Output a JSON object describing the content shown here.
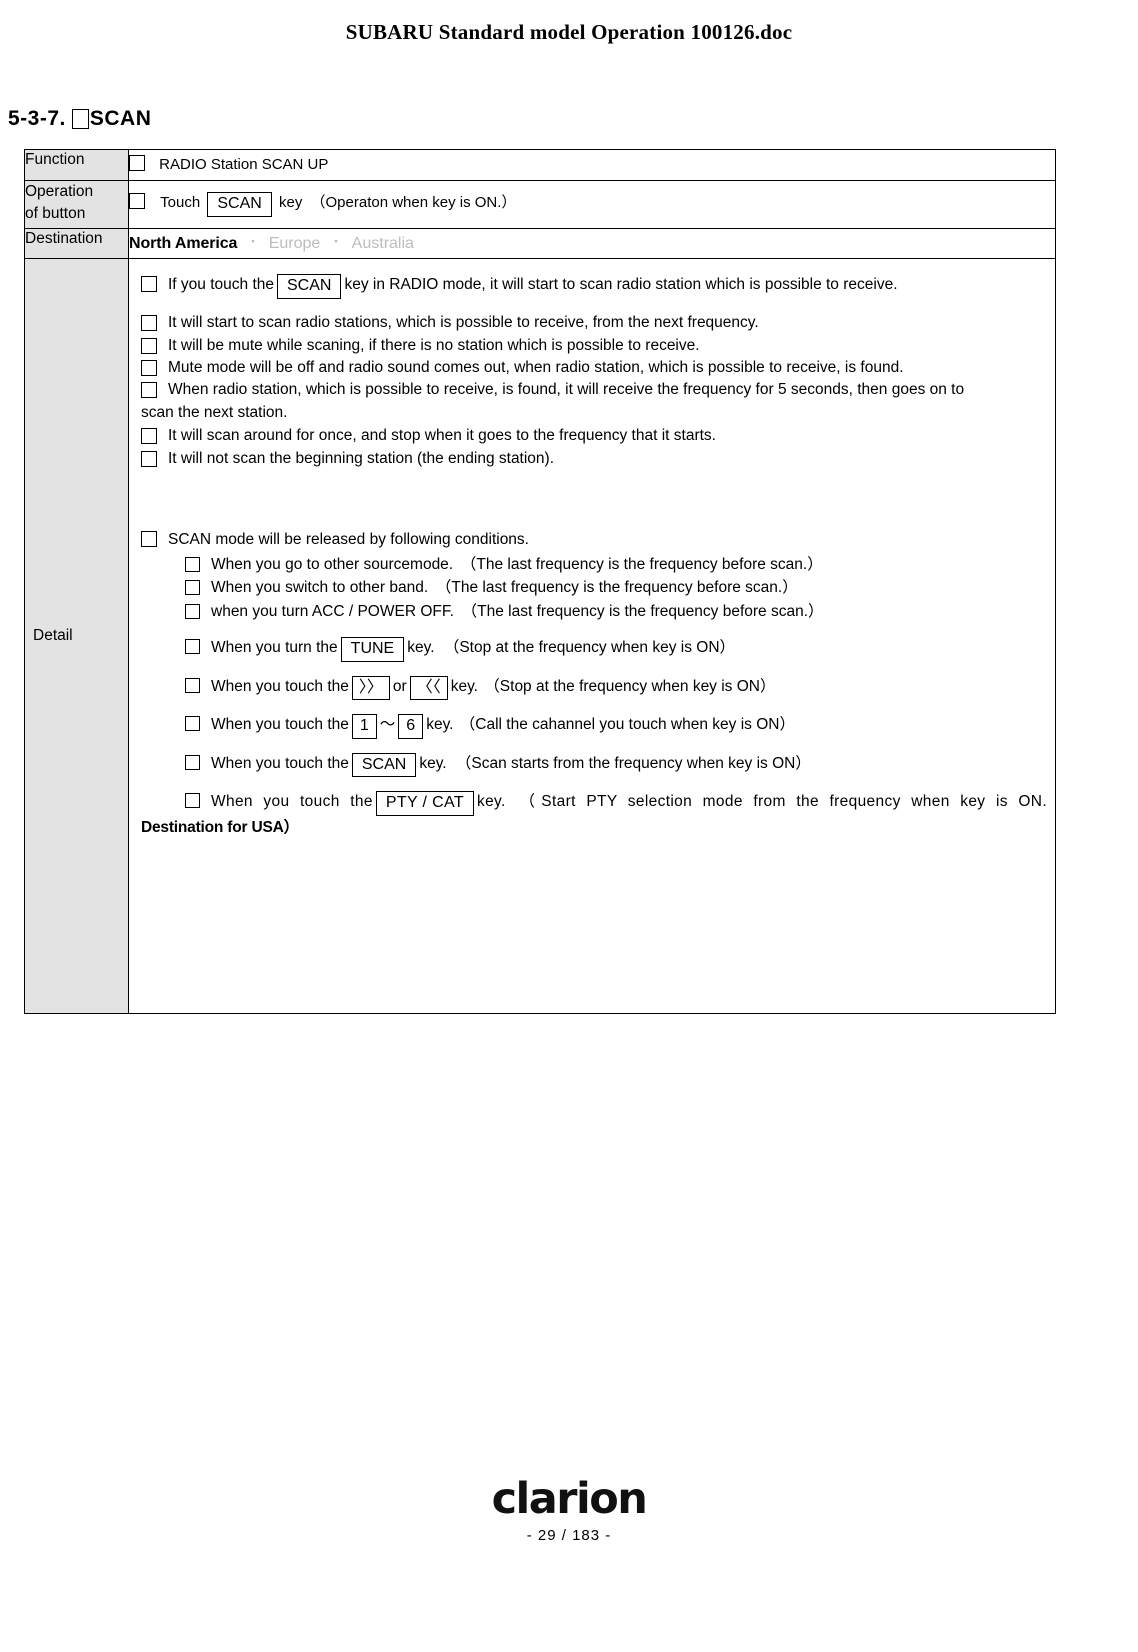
{
  "document": {
    "header_title": "SUBARU Standard model Operation 100126.doc",
    "section_number": "5-3-7.",
    "section_title": "SCAN"
  },
  "table": {
    "labels": {
      "function": "Function",
      "operation_line1": "Operation",
      "operation_line2": "of button",
      "destination": "Destination",
      "detail": "Detail"
    },
    "function": {
      "text": "RADIO Station SCAN  UP"
    },
    "operation": {
      "prefix": "Touch",
      "key": "SCAN",
      "suffix": "key",
      "note": "（Operaton when key is ON.）"
    },
    "destination": {
      "active": "North America",
      "separator": "・",
      "option2": "Europe",
      "option3": "Australia"
    },
    "detail": {
      "intro": {
        "prefix": "If you touch the",
        "key": "SCAN",
        "suffix": "key in RADIO mode, it will start to scan radio station which is possible to receive."
      },
      "bullets": [
        "It will start to scan radio stations, which is possible to receive, from the next frequency.",
        "It will be mute while scaning, if there is no station which is possible to receive.",
        "Mute mode will be off and radio sound comes out, when radio station, which is possible to receive, is found."
      ],
      "bullet_wrap": {
        "line1": "When radio station, which is possible to receive, is found, it will receive the frequency for 5 seconds, then goes on to",
        "line2": "scan the next station."
      },
      "bullets2": [
        "It will scan around for once, and stop when it goes to the frequency that it starts.",
        "It will not scan the beginning station (the ending station)."
      ],
      "release_heading": "SCAN mode will be released by following conditions.",
      "release_simple": [
        "When you go to other sourcemode.　（The last frequency is the frequency before scan.）",
        "When you switch to other band.　（The last frequency is the frequency before scan.）",
        "when you turn ACC / POWER  OFF.　（The last frequency is the frequency before scan.）"
      ],
      "release_keys": [
        {
          "prefix": "When you turn the",
          "key1": "TUNE",
          "mid": "",
          "key2": "",
          "suffix": "key.",
          "note": "（Stop at the frequency when key is ON）"
        },
        {
          "prefix": "When you touch the",
          "key1": "〉〉",
          "mid": "or",
          "key2": "〈〈",
          "suffix": "key.",
          "note": "（Stop at the frequency when key is ON）"
        },
        {
          "prefix": "When you touch the",
          "key1": "1",
          "mid": "～",
          "key2": "6",
          "suffix": "key.",
          "note": "（Call the cahannel you touch when key is ON）"
        },
        {
          "prefix": "When you touch the",
          "key1": "SCAN",
          "mid": "",
          "key2": "",
          "suffix": "key.",
          "note": "（Scan starts from the frequency when key is ON）"
        },
        {
          "prefix": "When you touch the",
          "key1": "PTY / CAT",
          "mid": "",
          "key2": "",
          "suffix": "key.",
          "note": "（Start PTY selection mode from the frequency when key is ON."
        }
      ],
      "usa_note": "Destination for USA）"
    }
  },
  "footer": {
    "logo": "clarion",
    "page": "- 29 / 183 -"
  }
}
